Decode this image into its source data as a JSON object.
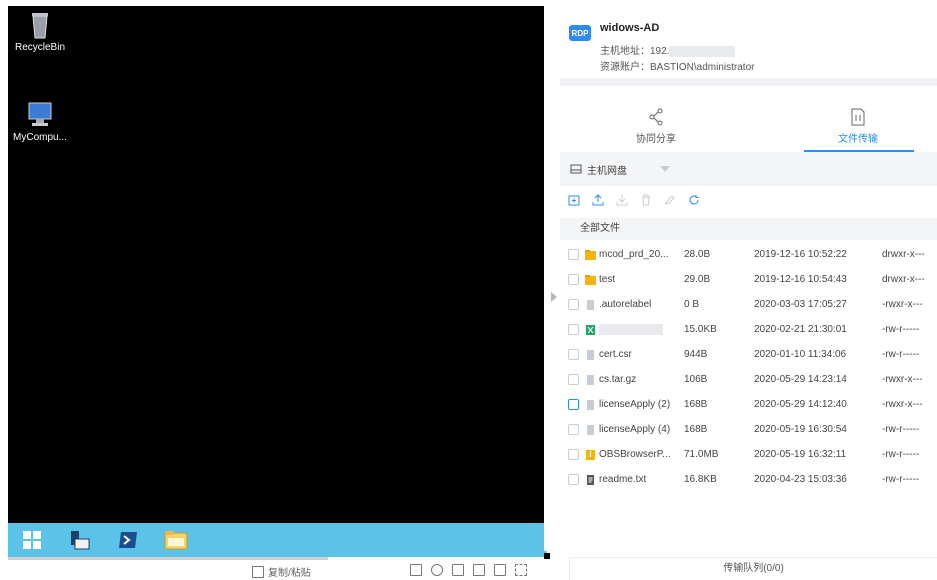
{
  "desktop": {
    "icons": [
      {
        "label": "RecycleBin",
        "icon": "recycle-bin-icon"
      },
      {
        "label": "MyCompu...",
        "icon": "computer-icon"
      }
    ],
    "taskbar": [
      "windows-start-icon",
      "server-manager-icon",
      "powershell-icon",
      "file-explorer-icon"
    ]
  },
  "bottom_bar": {
    "copy_paste": "复制/粘贴"
  },
  "resource": {
    "badge": "RDP",
    "name": "widows-AD",
    "host_label": "主机地址：192.",
    "account_label": "资源账户：BASTION\\administrator"
  },
  "tabs": [
    {
      "label": "协同分享",
      "icon": "share-icon"
    },
    {
      "label": "文件传输",
      "icon": "file-transfer-icon",
      "active": true
    }
  ],
  "disk": {
    "label": "主机网盘"
  },
  "list_header": "全部文件",
  "files": [
    {
      "name": "mcod_prd_20...",
      "size": "28.0B",
      "date": "2019-12-16 10:52:22",
      "perm": "drwxr-x---",
      "type": "folder"
    },
    {
      "name": "test",
      "size": "29.0B",
      "date": "2019-12-16 10:54:43",
      "perm": "drwxr-x---",
      "type": "folder"
    },
    {
      "name": ".autorelabel",
      "size": "0 B",
      "date": "2020-03-03 17:05:27",
      "perm": "-rwxr-x---",
      "type": "file"
    },
    {
      "name": "",
      "size": "15.0KB",
      "date": "2020-02-21 21:30:01",
      "perm": "-rw-r-----",
      "type": "excel"
    },
    {
      "name": "cert.csr",
      "size": "944B",
      "date": "2020-01-10 11:34:06",
      "perm": "-rw-r-----",
      "type": "file"
    },
    {
      "name": "cs.tar.gz",
      "size": "106B",
      "date": "2020-05-29 14:23:14",
      "perm": "-rwxr-x---",
      "type": "file"
    },
    {
      "name": "licenseApply (2)",
      "size": "168B",
      "date": "2020-05-29 14:12:40",
      "perm": "-rwxr-x---",
      "type": "file"
    },
    {
      "name": "licenseApply (4)",
      "size": "168B",
      "date": "2020-05-19 16:30:54",
      "perm": "-rw-r-----",
      "type": "file"
    },
    {
      "name": "OBSBrowserP...",
      "size": "71.0MB",
      "date": "2020-05-19 16:32:11",
      "perm": "-rw-r-----",
      "type": "archive"
    },
    {
      "name": "readme.txt",
      "size": "16.8KB",
      "date": "2020-04-23 15:03:36",
      "perm": "-rw-r-----",
      "type": "text"
    }
  ],
  "queue": "传输队列(0/0)",
  "colors": {
    "accent": "#2d8cf0",
    "taskbar": "#5bc3e8",
    "folder": "#f5b400",
    "excel": "#21a366"
  }
}
